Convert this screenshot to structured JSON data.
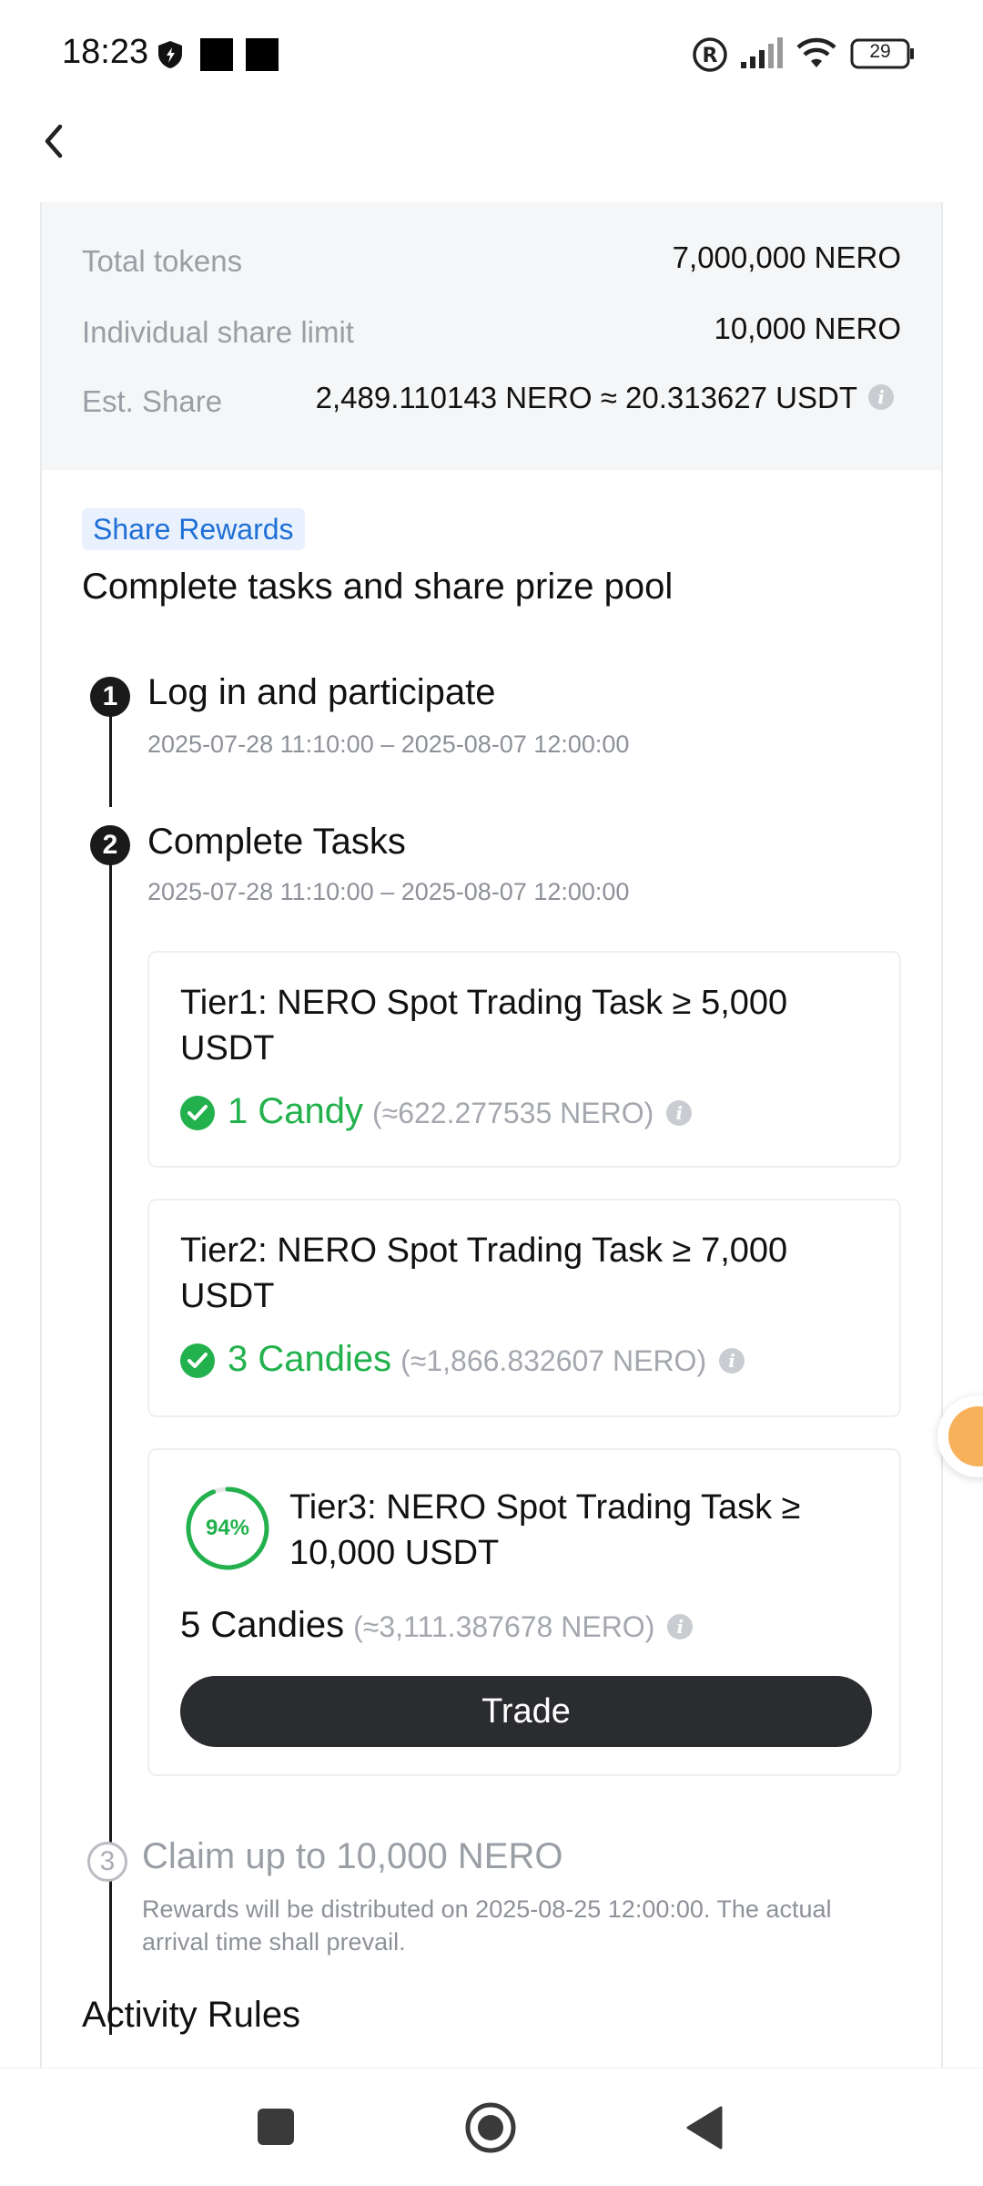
{
  "status_bar": {
    "time": "18:23",
    "battery": "29",
    "icons": [
      "shield-icon",
      "notification-square-icon",
      "notification-square-icon",
      "registered-icon",
      "signal-icon",
      "wifi-icon",
      "battery-icon"
    ]
  },
  "header": {
    "back_icon": "chevron-left-icon"
  },
  "summary": {
    "total_tokens_label": "Total tokens",
    "total_tokens_value": "7,000,000 NERO",
    "share_limit_label": "Individual share limit",
    "share_limit_value": "10,000 NERO",
    "est_share_label": "Est. Share",
    "est_share_value": "2,489.110143 NERO ≈ 20.313627 USDT"
  },
  "section": {
    "tag": "Share Rewards",
    "headline": "Complete tasks and share prize pool"
  },
  "steps": [
    {
      "number": "1",
      "title": "Log in and participate",
      "date": "2025-07-28 11:10:00 – 2025-08-07 12:00:00"
    },
    {
      "number": "2",
      "title": "Complete Tasks",
      "date": "2025-07-28 11:10:00 – 2025-08-07 12:00:00"
    },
    {
      "number": "3",
      "title": "Claim up to 10,000 NERO",
      "note": "Rewards will be distributed on 2025-08-25 12:00:00. The actual arrival time shall prevail."
    }
  ],
  "tiers": [
    {
      "title_line1": "Tier1: NERO Spot Trading Task ≥ 5,000",
      "title_line2": "USDT",
      "reward": "1 Candy",
      "approx": "(≈622.277535 NERO)",
      "completed": true
    },
    {
      "title_line1": "Tier2: NERO Spot Trading Task ≥ 7,000",
      "title_line2": "USDT",
      "reward": "3 Candies",
      "approx": "(≈1,866.832607 NERO)",
      "completed": true
    },
    {
      "title_line1": "Tier3: NERO Spot Trading Task ≥",
      "title_line2": "10,000 USDT",
      "reward": "5 Candies",
      "approx": "(≈3,111.387678 NERO)",
      "completed": false,
      "progress_label": "94%",
      "progress_fraction": 0.94,
      "button": "Trade"
    }
  ],
  "rules": {
    "title": "Activity Rules"
  },
  "colors": {
    "accent_green": "#22b14c",
    "tag_blue": "#1f6fd6",
    "button_dark": "#2b2c2f",
    "summary_bg": "#f5f6f7"
  }
}
